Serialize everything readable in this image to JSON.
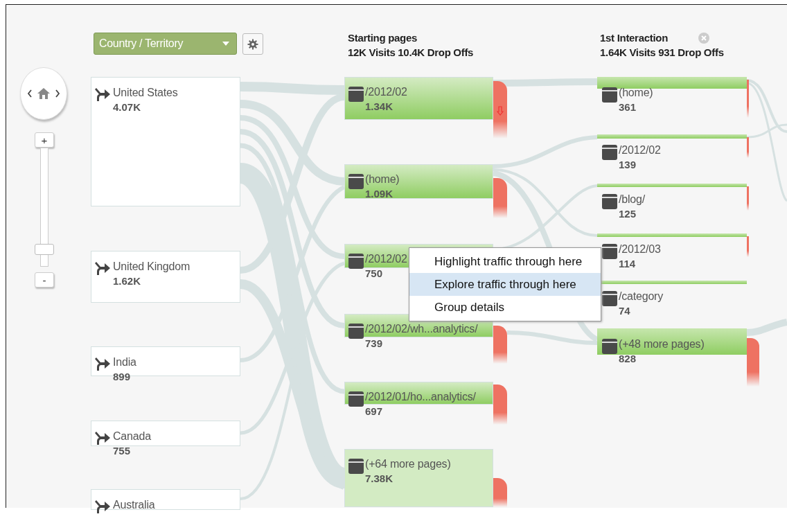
{
  "dimension_dropdown": {
    "label": "Country / Territory"
  },
  "zoom": {
    "zoom_in": "+",
    "zoom_out": "-",
    "level": 0.1
  },
  "countries": [
    {
      "name": "United States",
      "value": "4.07K"
    },
    {
      "name": "United Kingdom",
      "value": "1.62K"
    },
    {
      "name": "India",
      "value": "899"
    },
    {
      "name": "Canada",
      "value": "755"
    },
    {
      "name": "Australia"
    }
  ],
  "starting_pages": {
    "title": "Starting pages",
    "summary": "12K Visits 10.4K Drop Offs",
    "nodes": [
      {
        "label": "/2012/02",
        "value": "1.34K",
        "drop_arrow": true
      },
      {
        "label": "(home)",
        "value": "1.09K",
        "drop_arrow": false
      },
      {
        "label": "/2012/02",
        "value": "750",
        "drop_arrow": false
      },
      {
        "label": "/2012/02/wh...analytics/",
        "value": "739",
        "drop_arrow": false
      },
      {
        "label": "/2012/01/ho...analytics/",
        "value": "697",
        "drop_arrow": false
      },
      {
        "label": "(+64 more pages)",
        "value": "7.38K",
        "drop_arrow": false
      }
    ]
  },
  "first_interaction": {
    "title": "1st Interaction",
    "summary": "1.64K Visits 931 Drop Offs",
    "nodes": [
      {
        "label": "(home)",
        "value": "361"
      },
      {
        "label": "/2012/02",
        "value": "139"
      },
      {
        "label": "/blog/",
        "value": "125"
      },
      {
        "label": "/2012/03",
        "value": "114"
      },
      {
        "label": "/category",
        "value": "74"
      },
      {
        "label": "(+48 more pages)",
        "value": "828"
      }
    ]
  },
  "context_menu": {
    "items": [
      {
        "label": "Highlight traffic through here",
        "selected": false
      },
      {
        "label": "Explore traffic through here",
        "selected": true
      },
      {
        "label": "Group details",
        "selected": false
      }
    ]
  }
}
